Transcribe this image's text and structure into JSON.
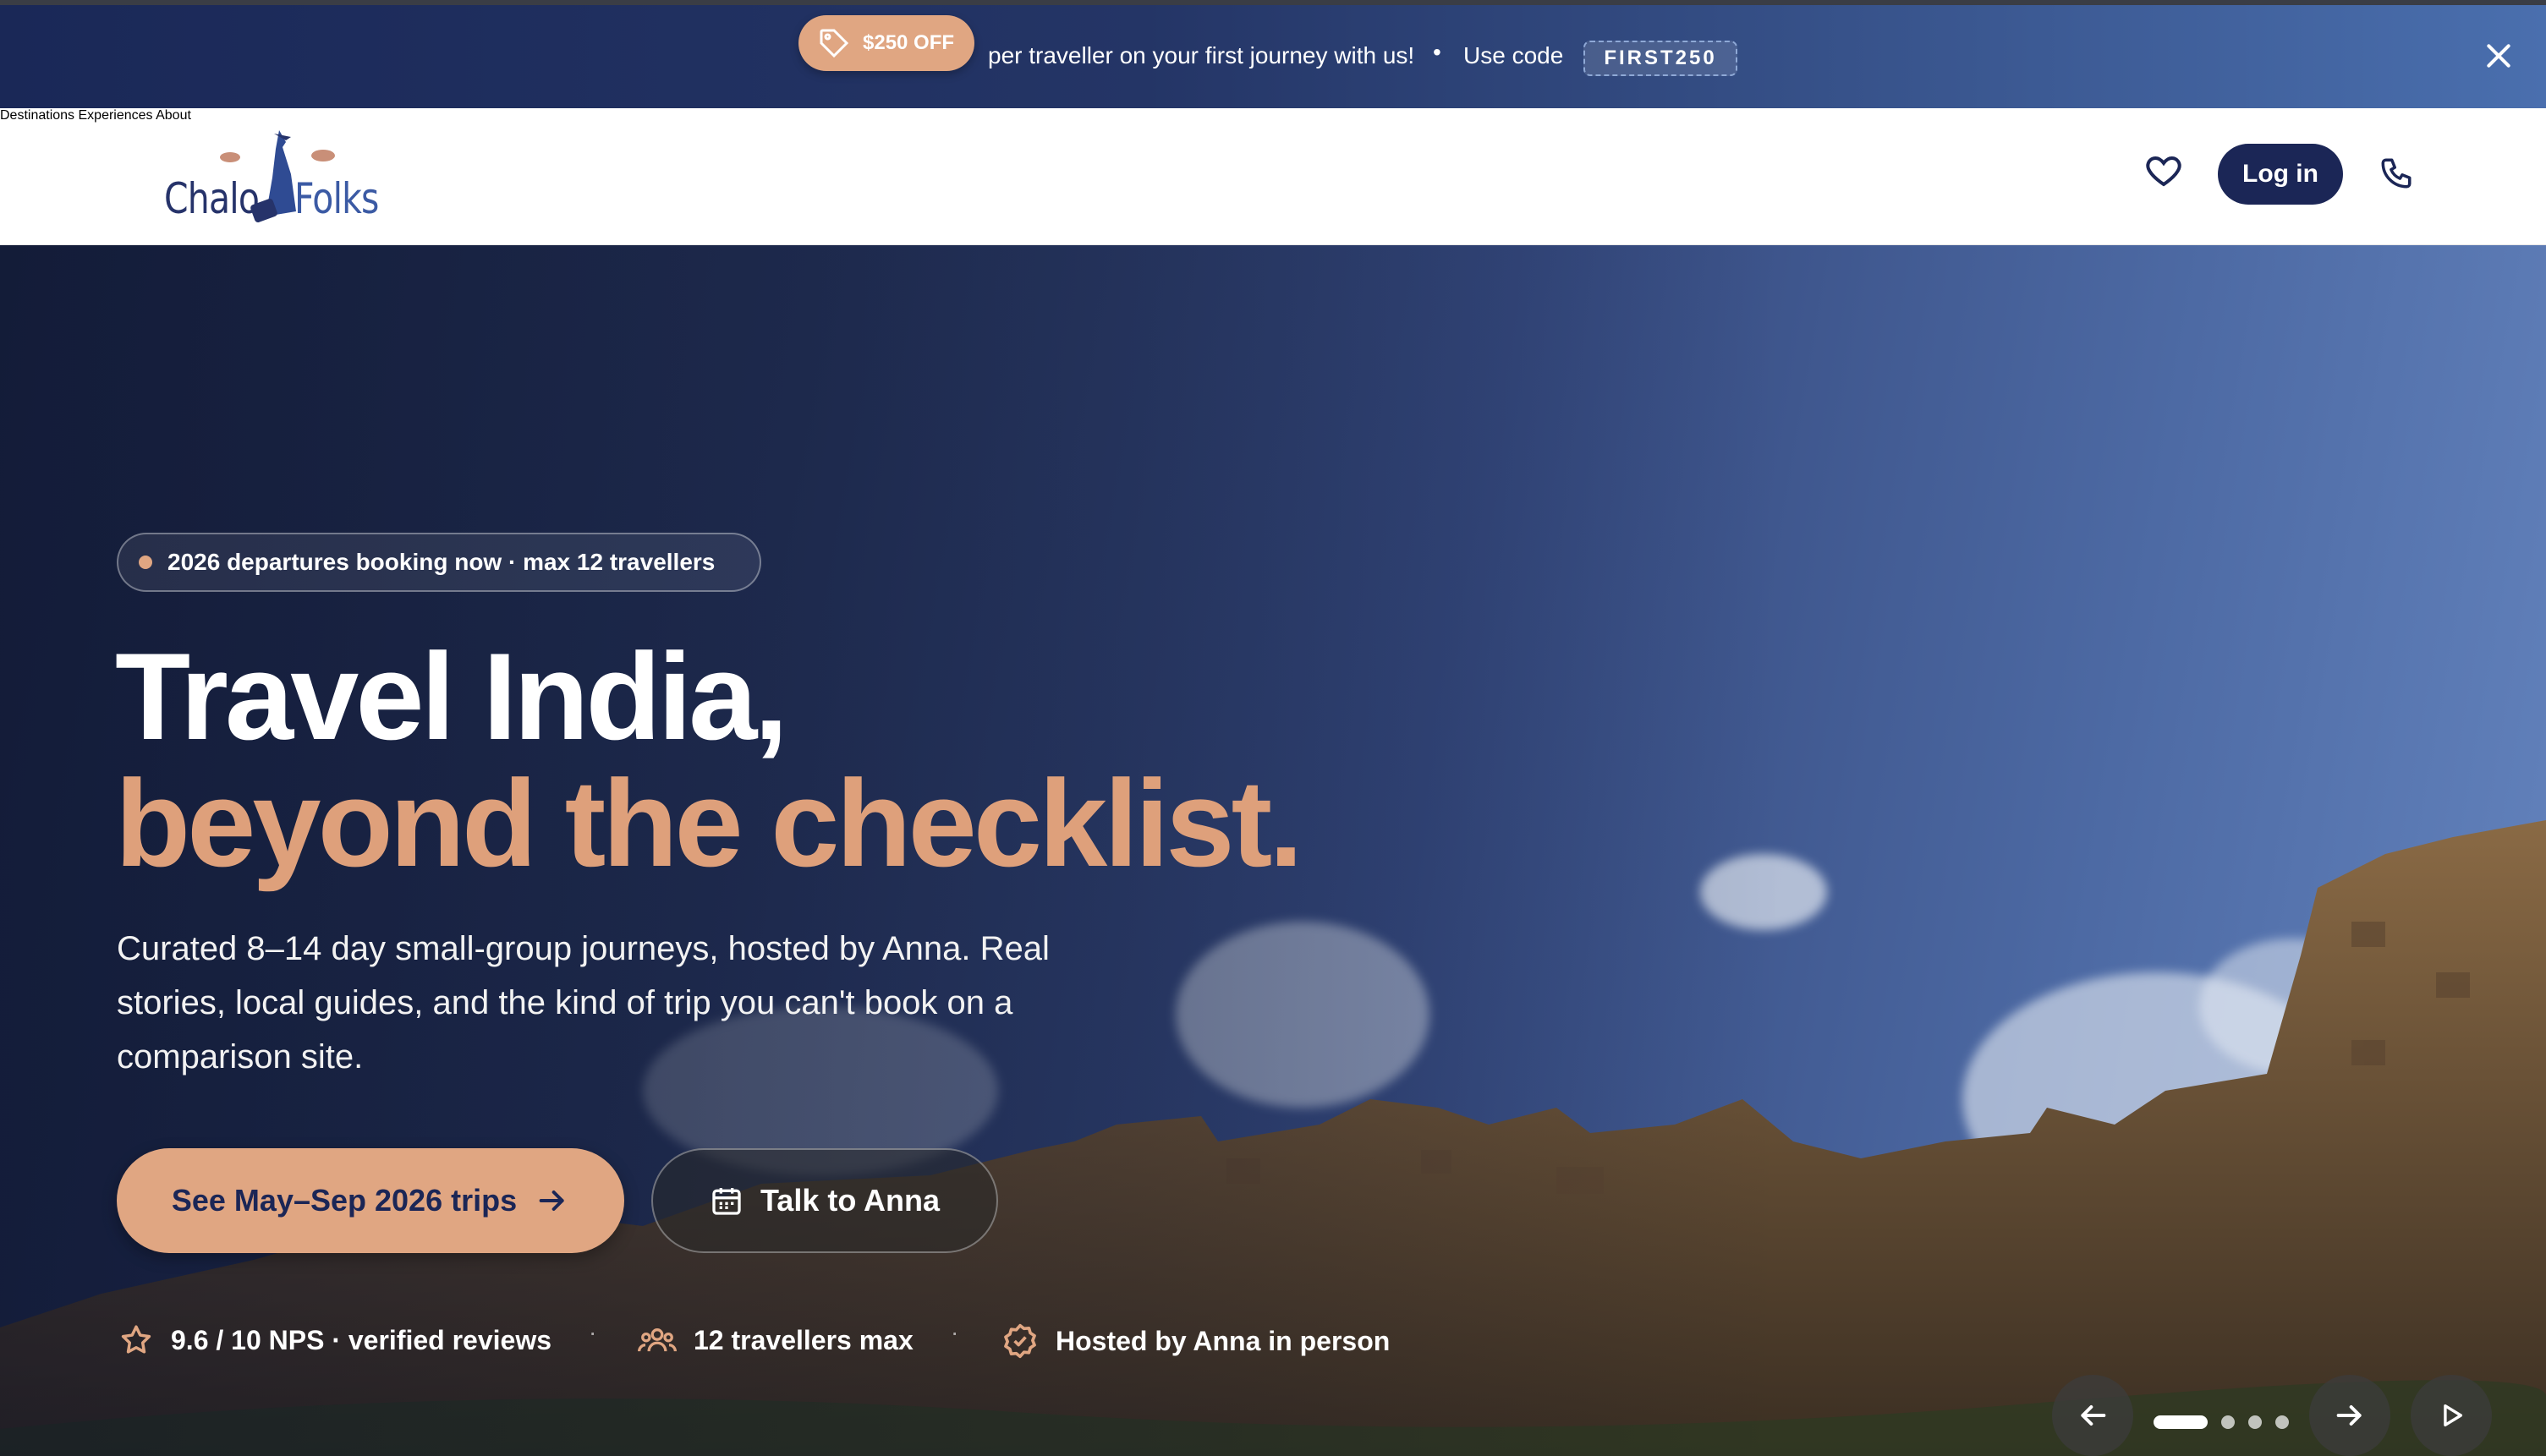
{
  "promo": {
    "badge": "$250 OFF",
    "text": "per traveller on your first journey with us!",
    "separator": "•",
    "use_code_label": "Use code",
    "code": "FIRST250",
    "tag_icon": "tag-icon",
    "close_icon": "close-icon"
  },
  "header": {
    "logo": {
      "left": "Chalo",
      "right": "Folks"
    },
    "nav": [
      "Destinations",
      "Experiences",
      "About"
    ],
    "favorites_icon": "heart-icon",
    "login_label": "Log in",
    "phone_icon": "phone-icon"
  },
  "hero": {
    "badge": "2026 departures booking now · max 12 travellers",
    "headline_line1": "Travel India,",
    "headline_line2": "beyond the checklist.",
    "lead": "Curated 8–14 day small-group journeys, hosted by Anna. Real stories, local guides, and the kind of trip you can't book on a comparison site.",
    "cta_primary": "See May–Sep 2026 trips",
    "cta_secondary": "Talk to Anna",
    "trust": [
      {
        "icon": "star-icon",
        "label": "9.6 / 10 NPS · verified reviews"
      },
      {
        "icon": "group-icon",
        "label": "12 travellers max"
      },
      {
        "icon": "verified-badge-icon",
        "label": "Hosted by Anna in person"
      }
    ],
    "trust_separator": "·",
    "carousel": {
      "slides": 4,
      "active": 1
    }
  },
  "colors": {
    "accent": "#e0a682",
    "navy": "#1b2656",
    "headline_accent": "#dea07b"
  }
}
